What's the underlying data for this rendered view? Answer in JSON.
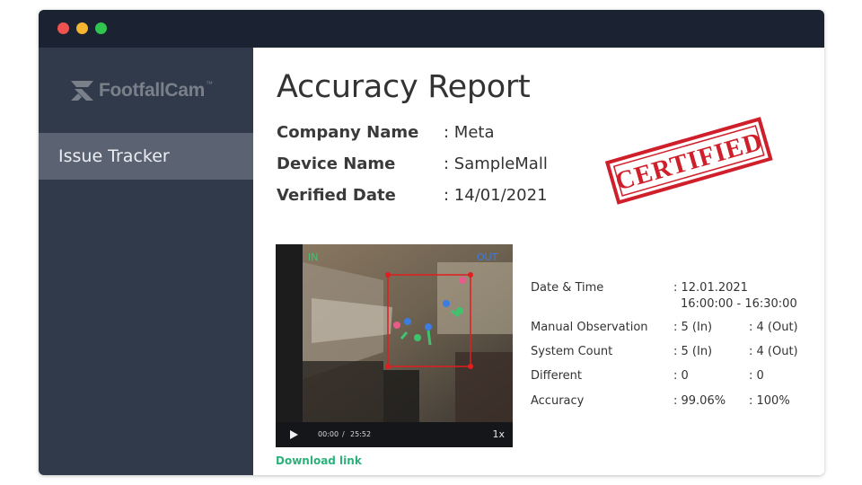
{
  "window": {
    "controls": [
      "close",
      "minimize",
      "maximize"
    ]
  },
  "sidebar": {
    "logo": {
      "text": "FootfallCam",
      "trademark": "™"
    },
    "items": [
      {
        "label": "Issue Tracker",
        "active": true
      }
    ]
  },
  "report": {
    "title": "Accuracy Report",
    "fields": [
      {
        "label": "Company Name",
        "value": ": Meta"
      },
      {
        "label": "Device Name",
        "value": ": SampleMall"
      },
      {
        "label": "Verified Date",
        "value": ": 14/01/2021"
      }
    ],
    "stamp": {
      "text": "CERTIFIED",
      "color": "#cf1f2b"
    }
  },
  "video": {
    "overlay_in": "IN",
    "overlay_out": "OUT",
    "current_time": "00:00",
    "separator": "/",
    "duration": "25:52",
    "speed": "1x",
    "box_color": "#e11d1d"
  },
  "download": {
    "label": "Download link",
    "color": "#2bb27b"
  },
  "stats": {
    "datetime": {
      "label": "Date & Time",
      "line1": ": 12.01.2021",
      "line2": "16:00:00 - 16:30:00"
    },
    "rows": [
      {
        "label": "Manual Observation",
        "in": ": 5 (In)",
        "out": ": 4 (Out)"
      },
      {
        "label": "System Count",
        "in": ": 5 (In)",
        "out": ": 4 (Out)"
      },
      {
        "label": "Different",
        "in": ": 0",
        "out": ": 0"
      },
      {
        "label": "Accuracy",
        "in": ": 99.06%",
        "out": ": 100%"
      }
    ]
  }
}
